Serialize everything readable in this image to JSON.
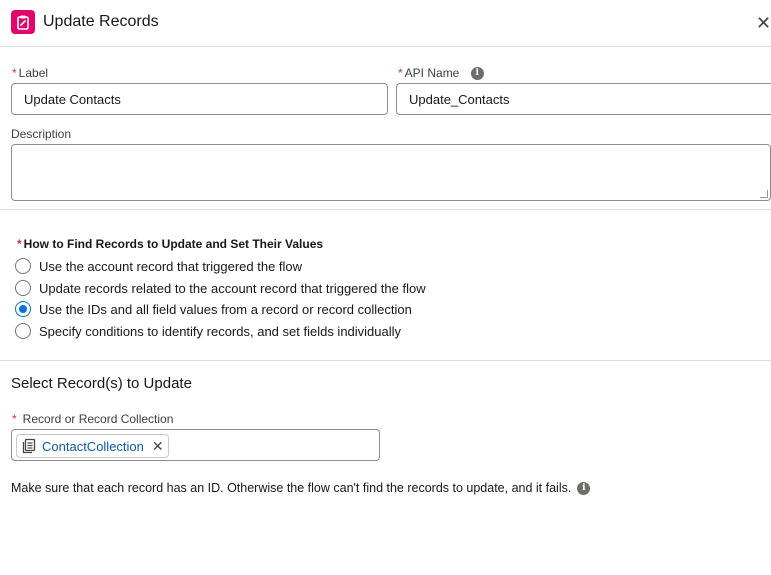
{
  "header": {
    "title": "Update Records",
    "icon": "clipboard-edit-icon",
    "close_symbol": "✕",
    "accent_color": "#e3066a"
  },
  "form": {
    "label": {
      "required_marker": "*",
      "text": "Label",
      "value": "Update Contacts"
    },
    "api_name": {
      "required_marker": "*",
      "text": "API Name",
      "value": "Update_Contacts"
    },
    "description": {
      "text": "Description",
      "value": ""
    }
  },
  "find_records": {
    "required_marker": "*",
    "question": "How to Find Records to Update and Set Their Values",
    "options": [
      {
        "label": "Use the account record that triggered the flow",
        "checked": false
      },
      {
        "label": "Update records related to the account record that triggered the flow",
        "checked": false
      },
      {
        "label": "Use the IDs and all field values from a record or record collection",
        "checked": true
      },
      {
        "label": "Specify conditions to identify records, and set fields individually",
        "checked": false
      }
    ]
  },
  "select_records": {
    "title": "Select Record(s) to Update",
    "field": {
      "required_marker": "*",
      "text": "Record or Record Collection"
    },
    "pill": {
      "label": "ContactCollection",
      "icon": "collection-icon",
      "remove_symbol": "✕"
    },
    "note": "Make sure that each record has an ID. Otherwise the flow can't find the records to update, and it fails."
  },
  "colors": {
    "primary": "#0176d3",
    "link": "#0b5cab",
    "required": "#c23934"
  }
}
